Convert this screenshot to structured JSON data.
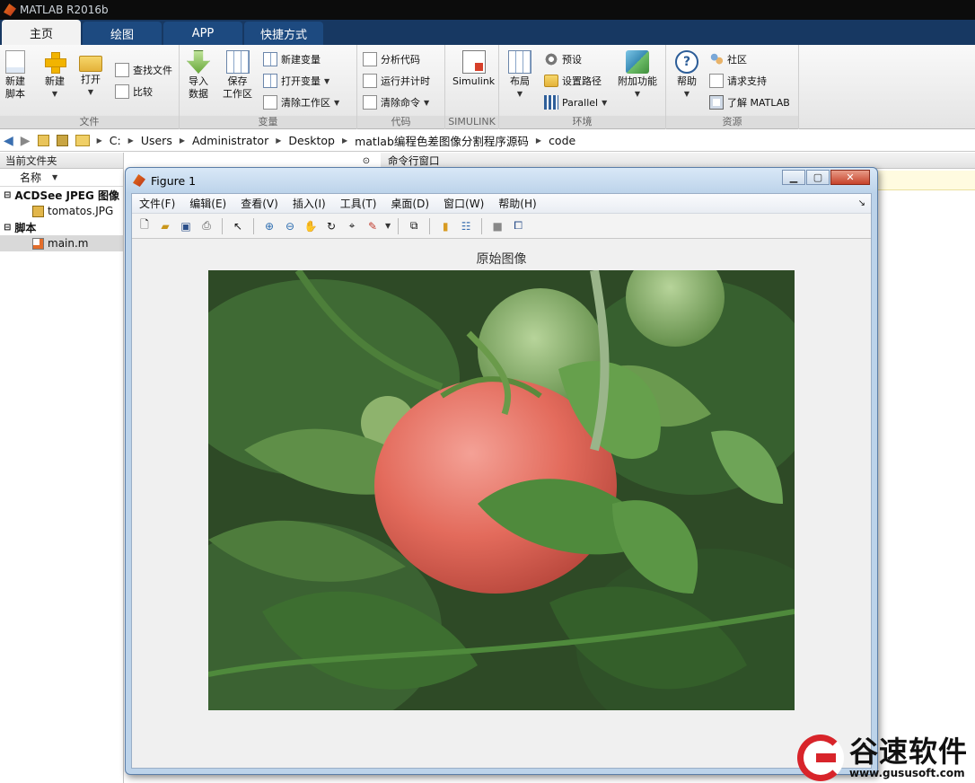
{
  "window": {
    "title": "MATLAB R2016b"
  },
  "tabs": [
    "主页",
    "绘图",
    "APP",
    "快捷方式"
  ],
  "ribbon": {
    "file": {
      "label": "文件",
      "new_script": [
        "新建",
        "脚本"
      ],
      "new": "新建",
      "open": "打开",
      "find_files": "查找文件",
      "compare": "比较"
    },
    "variable": {
      "label": "变量",
      "import": [
        "导入",
        "数据"
      ],
      "save_ws": [
        "保存",
        "工作区"
      ],
      "new_var": "新建变量",
      "open_var": "打开变量",
      "clear_ws": "清除工作区"
    },
    "code": {
      "label": "代码",
      "analyze": "分析代码",
      "run_time": "运行并计时",
      "clear_cmd": "清除命令"
    },
    "simulink": {
      "label": "SIMULINK",
      "simulink": "Simulink"
    },
    "env": {
      "label": "环境",
      "layout": "布局",
      "prefs": "预设",
      "set_path": "设置路径",
      "parallel": "Parallel",
      "addons": "附加功能"
    },
    "resources": {
      "label": "资源",
      "help": "帮助",
      "community": "社区",
      "request_support": "请求支持",
      "learn": "了解 MATLAB"
    }
  },
  "address": [
    "C:",
    "Users",
    "Administrator",
    "Desktop",
    "matlab编程色差图像分割程序源码",
    "code"
  ],
  "current_folder": {
    "title": "当前文件夹",
    "col_name": "名称",
    "groups": [
      {
        "name": "ACDSee JPEG 图像",
        "items": [
          "tomatos.JPG"
        ]
      },
      {
        "name": "脚本",
        "items": [
          "main.m"
        ]
      }
    ]
  },
  "command_window": {
    "title": "命令行窗口"
  },
  "figure": {
    "title": "Figure 1",
    "menu": [
      "文件(F)",
      "编辑(E)",
      "查看(V)",
      "插入(I)",
      "工具(T)",
      "桌面(D)",
      "窗口(W)",
      "帮助(H)"
    ],
    "axes_title": "原始图像"
  },
  "watermark": {
    "name": "谷速软件",
    "url": "www.gususoft.com"
  },
  "colors": {
    "tab_bar": "#173862",
    "figure_frame": "#bcd3ea",
    "tomato": "#e46a5a",
    "leaf": "#3f7a32"
  }
}
